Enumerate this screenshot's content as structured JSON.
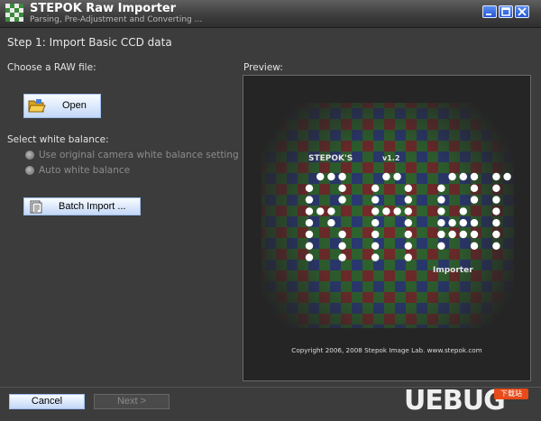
{
  "window": {
    "title": "STEPOK Raw Importer",
    "subtitle": "Parsing, Pre-Adjustment and Converting ..."
  },
  "step": {
    "heading": "Step 1: Import Basic CCD data"
  },
  "file": {
    "label": "Choose a RAW file:",
    "open_label": "Open"
  },
  "white_balance": {
    "label": "Select white balance:",
    "options": [
      {
        "label": "Use original camera white balance setting",
        "enabled": false
      },
      {
        "label": "Auto white balance",
        "enabled": false
      }
    ]
  },
  "batch": {
    "label": "Batch Import ..."
  },
  "preview": {
    "label": "Preview:",
    "logo_brand": "STEPOK'S",
    "logo_version": "v1.2",
    "logo_name": "Importer",
    "copyright": "Copyright 2006, 2008 Stepok Image Lab. www.stepok.com"
  },
  "footer": {
    "cancel_label": "Cancel",
    "next_label": "Next >"
  },
  "watermark": {
    "brand": "UEBUG",
    "site": "下载站"
  },
  "colors": {
    "background": "#3c3c3c",
    "button_face": "#d8e6fb",
    "title_blue": "#2456d6"
  },
  "icons": [
    "app-logo-icon",
    "minimize-icon",
    "maximize-icon",
    "close-icon",
    "folder-open-icon",
    "batch-document-icon"
  ]
}
